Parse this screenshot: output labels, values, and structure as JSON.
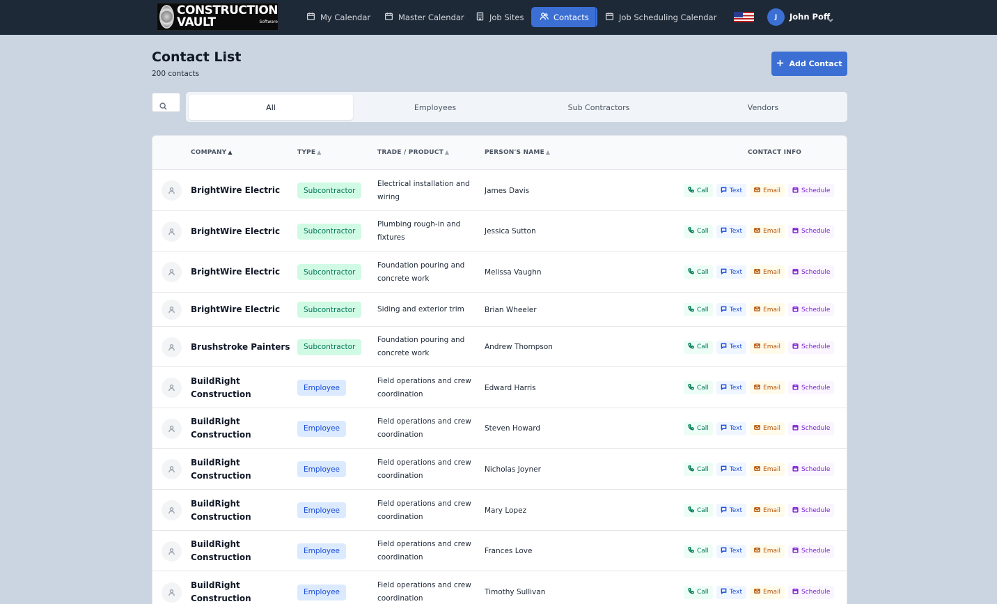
{
  "brand": {
    "line1": "CONSTRUCTION",
    "line2": "VAULT",
    "tagline": "Software"
  },
  "nav": {
    "items": [
      {
        "label": "My Calendar",
        "icon": "calendar-icon"
      },
      {
        "label": "Master Calendar",
        "icon": "calendar-icon"
      },
      {
        "label": "Job Sites",
        "icon": "building-icon"
      },
      {
        "label": "Contacts",
        "icon": "users-icon",
        "active": true
      },
      {
        "label": "Job Scheduling Calendar",
        "icon": "calendar-icon"
      }
    ],
    "locale_flag": "us-flag-icon",
    "user": {
      "initial": "J",
      "name": "John Poff"
    }
  },
  "header": {
    "title": "Contact List",
    "count": "200 contacts",
    "add_button": "Add Contact"
  },
  "search": {
    "placeholder": ""
  },
  "tabs": [
    "All",
    "Employees",
    "Sub Contractors",
    "Vendors"
  ],
  "table": {
    "columns": {
      "company": "COMPANY",
      "type": "TYPE",
      "trade": "TRADE / PRODUCT",
      "person": "PERSON'S NAME",
      "contact": "CONTACT INFO"
    },
    "action_labels": {
      "call": "Call",
      "text": "Text",
      "email": "Email",
      "schedule": "Schedule"
    },
    "rows": [
      {
        "company": "BrightWire Electric",
        "type": "Subcontractor",
        "trade": "Electrical installation and wiring",
        "person": "James Davis"
      },
      {
        "company": "BrightWire Electric",
        "type": "Subcontractor",
        "trade": "Plumbing rough-in and fixtures",
        "person": "Jessica Sutton"
      },
      {
        "company": "BrightWire Electric",
        "type": "Subcontractor",
        "trade": "Foundation pouring and concrete work",
        "person": "Melissa Vaughn"
      },
      {
        "company": "BrightWire Electric",
        "type": "Subcontractor",
        "trade": "Siding and exterior trim",
        "person": "Brian Wheeler"
      },
      {
        "company": "Brushstroke Painters",
        "type": "Subcontractor",
        "trade": "Foundation pouring and concrete work",
        "person": "Andrew Thompson"
      },
      {
        "company": "BuildRight Construction",
        "type": "Employee",
        "trade": "Field operations and crew coordination",
        "person": "Edward Harris"
      },
      {
        "company": "BuildRight Construction",
        "type": "Employee",
        "trade": "Field operations and crew coordination",
        "person": "Steven Howard"
      },
      {
        "company": "BuildRight Construction",
        "type": "Employee",
        "trade": "Field operations and crew coordination",
        "person": "Nicholas Joyner"
      },
      {
        "company": "BuildRight Construction",
        "type": "Employee",
        "trade": "Field operations and crew coordination",
        "person": "Mary Lopez"
      },
      {
        "company": "BuildRight Construction",
        "type": "Employee",
        "trade": "Field operations and crew coordination",
        "person": "Frances Love"
      },
      {
        "company": "BuildRight Construction",
        "type": "Employee",
        "trade": "Field operations and crew coordination",
        "person": "Timothy Sullivan"
      }
    ]
  }
}
